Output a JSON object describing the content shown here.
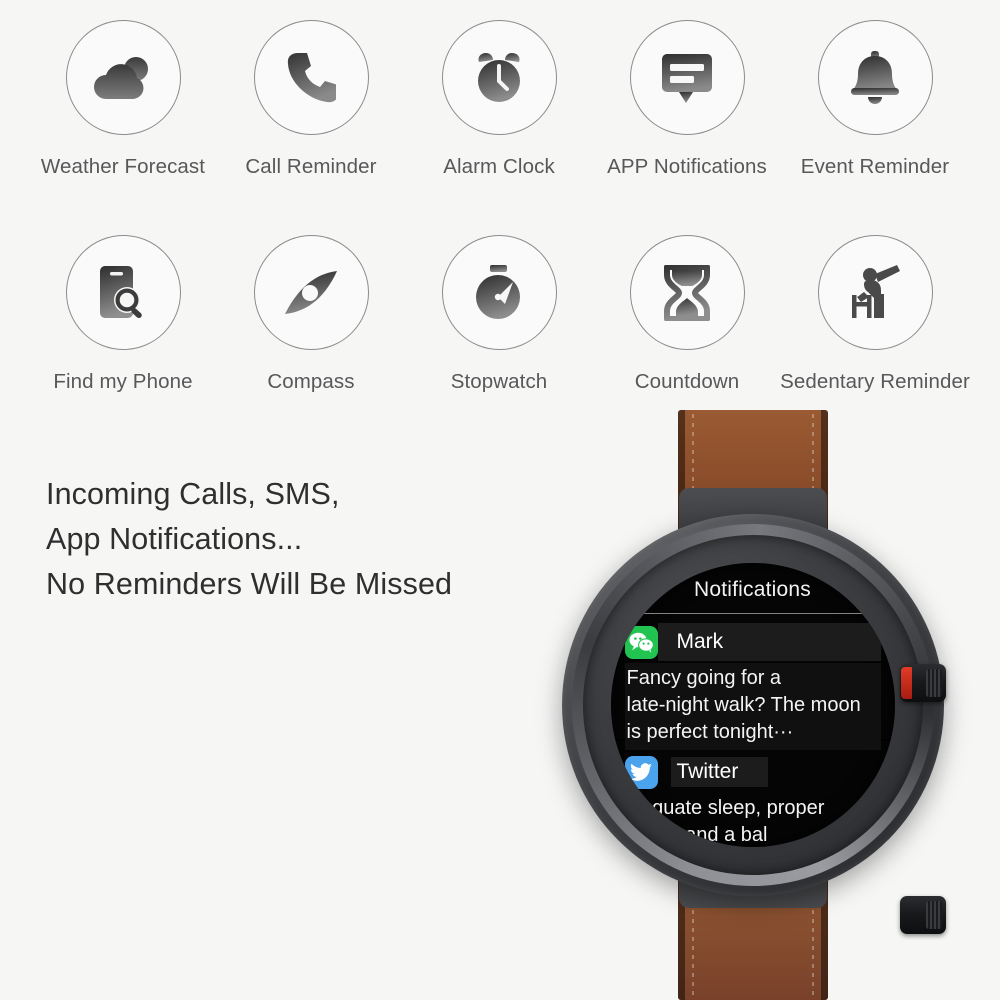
{
  "page": {
    "background_color": "#f6f6f5",
    "text_color": "#58585a",
    "headline_color": "#2f2f2f"
  },
  "features": {
    "rows": [
      {
        "items": [
          {
            "label": "Weather Forecast",
            "icon": "cloud-sun-icon"
          },
          {
            "label": "Call Reminder",
            "icon": "phone-icon"
          },
          {
            "label": "Alarm Clock",
            "icon": "alarm-clock-icon"
          },
          {
            "label": "APP Notifications",
            "icon": "chat-bubble-icon"
          },
          {
            "label": "Event Reminder",
            "icon": "bell-icon"
          }
        ]
      },
      {
        "items": [
          {
            "label": "Find my Phone",
            "icon": "phone-search-icon"
          },
          {
            "label": "Compass",
            "icon": "compass-icon"
          },
          {
            "label": "Stopwatch",
            "icon": "stopwatch-icon"
          },
          {
            "label": "Countdown",
            "icon": "hourglass-icon"
          },
          {
            "label": "Sedentary Reminder",
            "icon": "stretching-person-icon"
          }
        ]
      }
    ]
  },
  "headline": {
    "lines": [
      "Incoming Calls, SMS,",
      "App Notifications...",
      "No Reminders Will Be Missed"
    ]
  },
  "watch": {
    "strap_color": "#8d4f2c",
    "case_color": "#3a3c3f",
    "crown_accent_color": "#e23b27",
    "screen": {
      "title": "Notifications",
      "notifications": [
        {
          "app": "WeChat",
          "app_icon": "wechat-icon",
          "app_icon_color": "#22c451",
          "sender": "Mark",
          "lines": [
            "Fancy going for a",
            "late-night walk? The moon",
            "is perfect tonight···"
          ]
        },
        {
          "app": "Twitter",
          "app_icon": "twitter-icon",
          "app_icon_color": "#4aa3ec",
          "sender": "Twitter",
          "lines": [
            "Adequate sleep, proper",
            "cise, and a bal"
          ]
        }
      ]
    }
  }
}
